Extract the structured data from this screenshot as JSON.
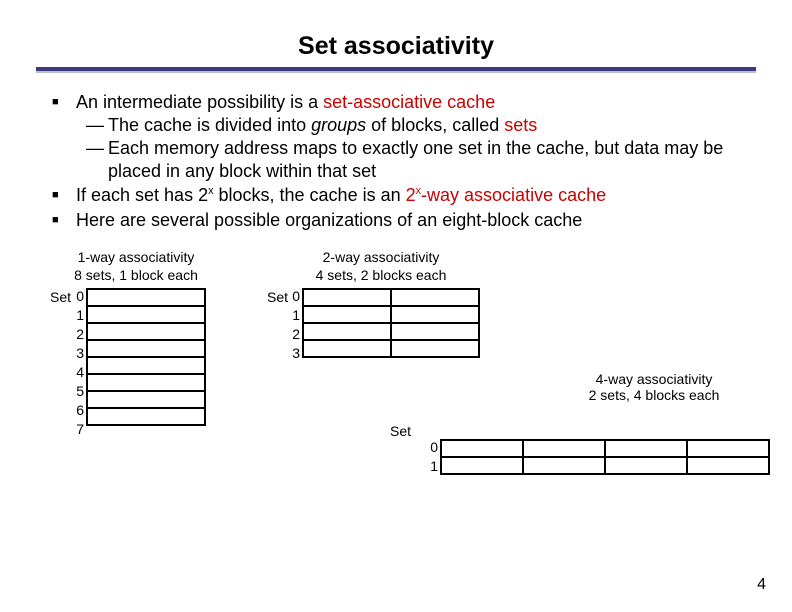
{
  "title": "Set associativity",
  "bullets": {
    "b1_pre": "An intermediate possibility is a ",
    "b1_term": "set-associative cache",
    "s1a_pre": "The cache is divided into ",
    "s1a_em": "groups",
    "s1a_mid": " of blocks, called ",
    "s1a_term": "sets",
    "s1b": "Each memory address maps to exactly one set in the cache, but data may be placed in any block within that set",
    "b2_pre": "If each set has 2",
    "b2_sup": "x",
    "b2_mid": " blocks, the cache is an ",
    "b2_term_a": "2",
    "b2_term_sup": "x",
    "b2_term_b": "-way associative cache",
    "b3": "Here are several possible organizations of an eight-block cache"
  },
  "diagrams": {
    "d1": {
      "line1": "1-way associativity",
      "line2": "8 sets, 1 block each",
      "set": "Set",
      "labels": [
        "0",
        "1",
        "2",
        "3",
        "4",
        "5",
        "6",
        "7"
      ]
    },
    "d2": {
      "line1": "2-way associativity",
      "line2": "4 sets, 2 blocks each",
      "set": "Set",
      "labels": [
        "0",
        "1",
        "2",
        "3"
      ]
    },
    "d4": {
      "line1": "4-way associativity",
      "line2": "2 sets, 4 blocks each",
      "set": "Set",
      "labels": [
        "0",
        "1"
      ]
    }
  },
  "page": "4",
  "chart_data": [
    {
      "type": "table",
      "title": "1-way associativity",
      "subtitle": "8 sets, 1 block each",
      "rows": 8,
      "cols": 1,
      "row_labels": [
        "0",
        "1",
        "2",
        "3",
        "4",
        "5",
        "6",
        "7"
      ]
    },
    {
      "type": "table",
      "title": "2-way associativity",
      "subtitle": "4 sets, 2 blocks each",
      "rows": 4,
      "cols": 2,
      "row_labels": [
        "0",
        "1",
        "2",
        "3"
      ]
    },
    {
      "type": "table",
      "title": "4-way associativity",
      "subtitle": "2 sets, 4 blocks each",
      "rows": 2,
      "cols": 4,
      "row_labels": [
        "0",
        "1"
      ]
    }
  ]
}
